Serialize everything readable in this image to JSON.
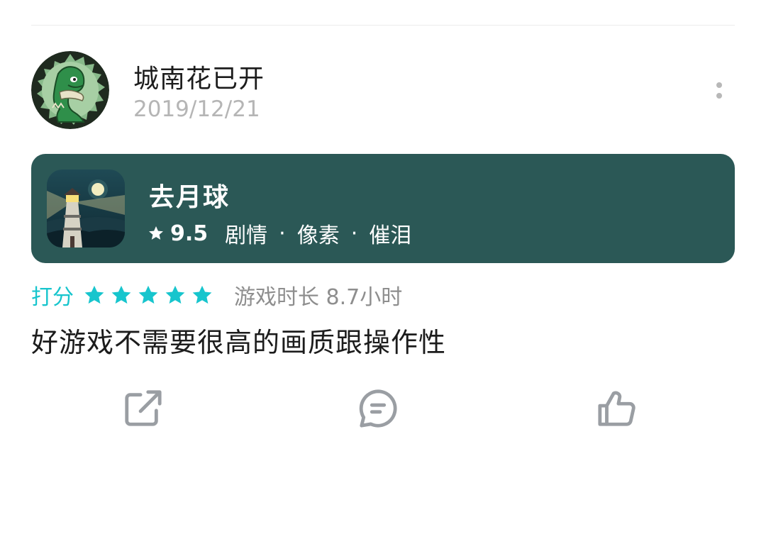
{
  "post": {
    "username": "城南花已开",
    "date": "2019/12/21"
  },
  "game": {
    "title": "去月球",
    "score": "9.5",
    "tags": [
      "剧情",
      "像素",
      "催泪"
    ],
    "separator": "·"
  },
  "rating": {
    "label": "打分",
    "stars": 5,
    "max_stars": 5,
    "playtime": "游戏时长 8.7小时"
  },
  "review": {
    "text": "好游戏不需要很高的画质跟操作性"
  },
  "actions": {
    "share_icon": "share-icon",
    "comment_icon": "comment-icon",
    "like_icon": "thumbs-up-icon"
  },
  "colors": {
    "card_bg": "#2b5856",
    "accent": "#17c5cd",
    "icon_gray": "#9a9ea3"
  }
}
